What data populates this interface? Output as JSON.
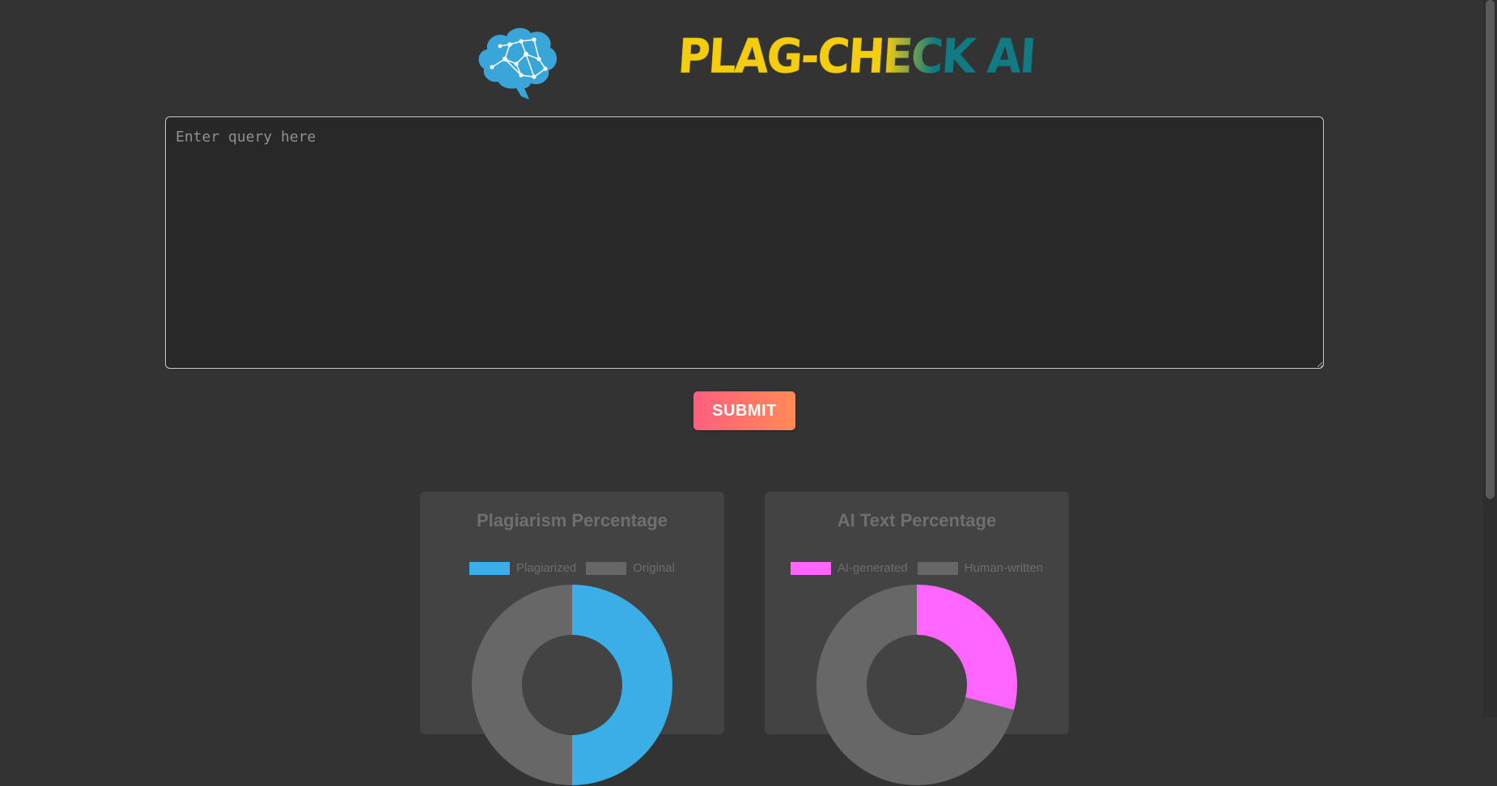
{
  "header": {
    "logo_text": "PLAG-CHECK AI",
    "logo_icon": "brain-network-icon"
  },
  "query": {
    "placeholder": "Enter query here",
    "value": ""
  },
  "submit": {
    "label": "SUBMIT"
  },
  "colors": {
    "background": "#333333",
    "card": "#434343",
    "plagiarized": "#3baee7",
    "ai_generated": "#ff66ff",
    "neutral": "#676767",
    "logo_yellow": "#f5cd0f",
    "logo_teal": "#117a82"
  },
  "chart_data": [
    {
      "type": "pie",
      "title": "Plagiarism Percentage",
      "categories": [
        "Plagiarized",
        "Original"
      ],
      "values": [
        50,
        50
      ],
      "colors": [
        "#3baee7",
        "#676767"
      ],
      "legend": "top"
    },
    {
      "type": "pie",
      "title": "AI Text Percentage",
      "categories": [
        "AI-generated",
        "Human-written"
      ],
      "values": [
        29,
        71
      ],
      "colors": [
        "#ff66ff",
        "#676767"
      ],
      "legend": "top"
    }
  ]
}
